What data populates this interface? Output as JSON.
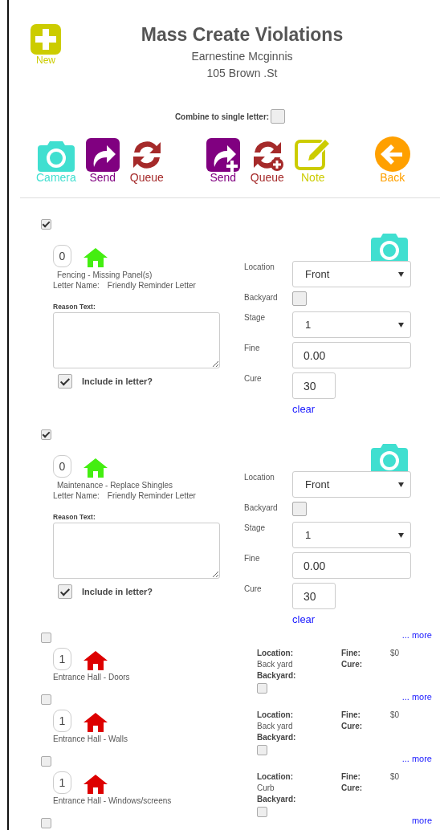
{
  "header": {
    "new_button": {
      "label": "New"
    },
    "title": "Mass Create Violations",
    "owner": "Earnestine Mcginnis",
    "address": "105 Brown .St"
  },
  "combine": {
    "label": "Combine to single letter:",
    "checked": false
  },
  "toolbar": [
    {
      "kind": "camera",
      "label": "Camera"
    },
    {
      "kind": "send",
      "label": "Send"
    },
    {
      "kind": "queue",
      "label": "Queue"
    },
    {
      "kind": "send-plus",
      "label": "Send"
    },
    {
      "kind": "queue-plus",
      "label": "Queue"
    },
    {
      "kind": "note",
      "label": "Note"
    },
    {
      "kind": "back",
      "label": "Back"
    }
  ],
  "violations": [
    {
      "kind": "expanded",
      "selected": true,
      "count": "0",
      "color": "#44ee11",
      "name": "Fencing - Missing Panel(s)",
      "letter_label": "Letter Name:",
      "letter_name": "Friendly Reminder Letter",
      "reason_label": "Reason Text:",
      "include_label": "Include in letter?",
      "include_checked": true,
      "location_label": "Location",
      "location": "Front",
      "backyard_label": "Backyard",
      "backyard_checked": false,
      "stage_label": "Stage",
      "stage": "1",
      "fine_label": "Fine",
      "fine": "0.00",
      "cure_label": "Cure",
      "cure": "30",
      "clear": "clear"
    },
    {
      "kind": "expanded",
      "selected": true,
      "count": "0",
      "color": "#44ee11",
      "name": "Maintenance - Replace Shingles",
      "letter_label": "Letter Name:",
      "letter_name": "Friendly Reminder Letter",
      "reason_label": "Reason Text:",
      "include_label": "Include in letter?",
      "include_checked": true,
      "location_label": "Location",
      "location": "Front",
      "backyard_label": "Backyard",
      "backyard_checked": false,
      "stage_label": "Stage",
      "stage": "1",
      "fine_label": "Fine",
      "fine": "0.00",
      "cure_label": "Cure",
      "cure": "30",
      "clear": "clear"
    },
    {
      "kind": "collapsed",
      "selected": false,
      "count": "1",
      "color": "#dd0000",
      "name": "Entrance Hall - Doors",
      "more": "... more",
      "location_label": "Location:",
      "location": "Back yard",
      "backyard_label": "Backyard:",
      "backyard_checked": false,
      "fine_label": "Fine:",
      "fine": "$0",
      "cure_label": "Cure:"
    },
    {
      "kind": "collapsed",
      "selected": false,
      "count": "1",
      "color": "#dd0000",
      "name": "Entrance Hall - Walls",
      "more": "... more",
      "location_label": "Location:",
      "location": "Back yard",
      "backyard_label": "Backyard:",
      "backyard_checked": false,
      "fine_label": "Fine:",
      "fine": "$0",
      "cure_label": "Cure:"
    },
    {
      "kind": "collapsed",
      "selected": false,
      "count": "1",
      "color": "#dd0000",
      "name": "Entrance Hall - Windows/screens",
      "more": "... more",
      "location_label": "Location:",
      "location": "Curb",
      "backyard_label": "Backyard:",
      "backyard_checked": false,
      "fine_label": "Fine:",
      "fine": "$0",
      "cure_label": "Cure:"
    },
    {
      "kind": "partial",
      "selected": false,
      "more": "more"
    }
  ]
}
